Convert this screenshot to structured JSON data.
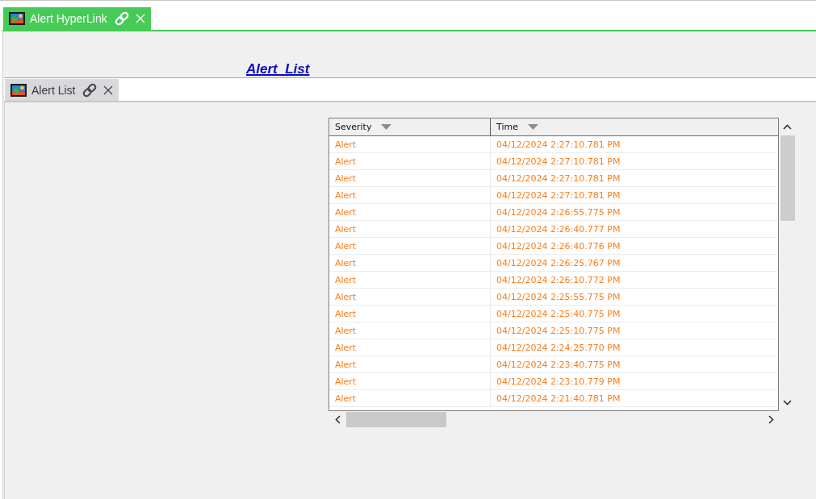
{
  "top_tab": {
    "title": "Alert HyperLink",
    "selected": true
  },
  "hyperlink": {
    "text": "Alert_List"
  },
  "alert_list_panel": {
    "tab": {
      "title": "Alert List",
      "selected": false
    },
    "table": {
      "columns": [
        {
          "label": "Severity"
        },
        {
          "label": "Time"
        }
      ],
      "rows": [
        {
          "severity": "Alert",
          "time": "04/12/2024 2:27:10.781 PM"
        },
        {
          "severity": "Alert",
          "time": "04/12/2024 2:27:10.781 PM"
        },
        {
          "severity": "Alert",
          "time": "04/12/2024 2:27:10.781 PM"
        },
        {
          "severity": "Alert",
          "time": "04/12/2024 2:27:10.781 PM"
        },
        {
          "severity": "Alert",
          "time": "04/12/2024 2:26:55.775 PM"
        },
        {
          "severity": "Alert",
          "time": "04/12/2024 2:26:40.777 PM"
        },
        {
          "severity": "Alert",
          "time": "04/12/2024 2:26:40.776 PM"
        },
        {
          "severity": "Alert",
          "time": "04/12/2024 2:26:25.767 PM"
        },
        {
          "severity": "Alert",
          "time": "04/12/2024 2:26:10.772 PM"
        },
        {
          "severity": "Alert",
          "time": "04/12/2024 2:25:55.775 PM"
        },
        {
          "severity": "Alert",
          "time": "04/12/2024 2:25:40.775 PM"
        },
        {
          "severity": "Alert",
          "time": "04/12/2024 2:25:10.775 PM"
        },
        {
          "severity": "Alert",
          "time": "04/12/2024 2:24:25.770 PM"
        },
        {
          "severity": "Alert",
          "time": "04/12/2024 2:23:40.775 PM"
        },
        {
          "severity": "Alert",
          "time": "04/12/2024 2:23:10.779 PM"
        },
        {
          "severity": "Alert",
          "time": "04/12/2024 2:21:40.781 PM"
        }
      ]
    }
  }
}
